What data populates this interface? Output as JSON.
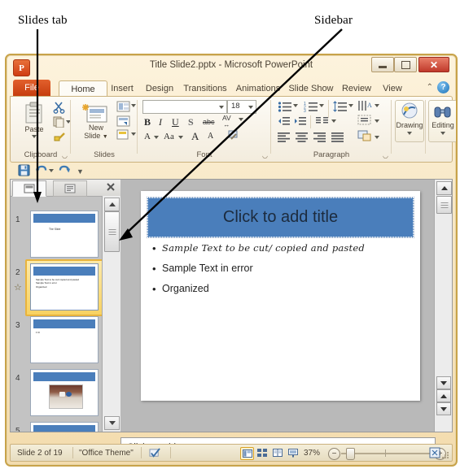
{
  "annotations": [
    {
      "id": "slides-tab",
      "label": "Slides tab"
    },
    {
      "id": "sidebar",
      "label": "Sidebar"
    }
  ],
  "window": {
    "title": "Title Slide2.pptx  -  Microsoft PowerPoint",
    "logo_text": "P",
    "buttons": {
      "minimize": "minimize-button",
      "maximize": "maximize-button",
      "close": "✕"
    }
  },
  "ribbon": {
    "file_tab": "File",
    "tabs": [
      {
        "label": "Home",
        "active": true
      },
      {
        "label": "Insert",
        "active": false
      },
      {
        "label": "Design",
        "active": false
      },
      {
        "label": "Transitions",
        "active": false
      },
      {
        "label": "Animations",
        "active": false
      },
      {
        "label": "Slide Show",
        "active": false
      },
      {
        "label": "Review",
        "active": false
      },
      {
        "label": "View",
        "active": false
      }
    ],
    "help_label": "?",
    "collapse_label": "⌃",
    "groups": [
      {
        "name": "Clipboard",
        "label": "Clipboard"
      },
      {
        "name": "Slides",
        "label": "Slides"
      },
      {
        "name": "Font",
        "label": "Font"
      },
      {
        "name": "Paragraph",
        "label": "Paragraph"
      },
      {
        "name": "Drawing",
        "label": "Drawing"
      },
      {
        "name": "Editing",
        "label": "Editing"
      }
    ],
    "clipboard": {
      "paste_label": "Paste"
    },
    "slides": {
      "new_slide_label": "New\nSlide"
    },
    "font": {
      "font_name_value": "",
      "font_size_value": "18",
      "bold": "B",
      "italic": "I",
      "underline": "U",
      "shadow": "S",
      "strikethrough": "abc",
      "spacing": "AV",
      "case_label": "Aa",
      "grow": "A",
      "shrink": "A",
      "color_label": "A"
    },
    "drawing": {
      "label": "Drawing"
    },
    "editing": {
      "label": "Editing"
    }
  },
  "quick_access": {
    "items": [
      {
        "name": "save-button",
        "label": "Save"
      },
      {
        "name": "undo-button",
        "label": "Undo"
      },
      {
        "name": "redo-button",
        "label": "Redo"
      },
      {
        "name": "customize-qat-button",
        "label": "Customize Quick Access Toolbar"
      }
    ]
  },
  "slides_pane": {
    "tabs": [
      {
        "name": "slides",
        "label": "Slides",
        "active": true
      },
      {
        "name": "outline",
        "label": "Outline",
        "active": false
      }
    ],
    "close_label": "✕",
    "thumbnails": [
      {
        "number": "1",
        "selected": false,
        "kind": "title",
        "caption": "The Slide"
      },
      {
        "number": "2",
        "selected": true,
        "kind": "bullets",
        "has_animation": true,
        "lines": [
          "Sample Text to be cut/ copied and pasted",
          "Sample Text in error",
          "Organized"
        ]
      },
      {
        "number": "3",
        "selected": false,
        "kind": "short",
        "lines": [
          "• ••"
        ]
      },
      {
        "number": "4",
        "selected": false,
        "kind": "image"
      },
      {
        "number": "5",
        "selected": false,
        "kind": "title"
      }
    ]
  },
  "slide": {
    "title_placeholder": "Click to add title",
    "bullets": [
      {
        "text": "Sample Text to be cut/ copied and pasted",
        "style": "script"
      },
      {
        "text": "Sample Text in error",
        "style": "normal"
      },
      {
        "text": "Organized",
        "style": "normal"
      }
    ]
  },
  "notes": {
    "placeholder": "Click to add notes"
  },
  "status_bar": {
    "slide_counter": "Slide 2 of 19",
    "theme": "\"Office Theme\"",
    "spellcheck_name": "spellcheck-icon",
    "views": [
      {
        "name": "normal-view-button",
        "active": true
      },
      {
        "name": "slide-sorter-view-button",
        "active": false
      },
      {
        "name": "reading-view-button",
        "active": false
      },
      {
        "name": "slideshow-view-button",
        "active": false
      }
    ],
    "zoom_level": "37%",
    "zoom_out_label": "−",
    "zoom_in_label": "+",
    "fit_label": "fit-to-window-button"
  },
  "colors": {
    "accent_blue": "#4a7ebb",
    "window_chrome": "#f3dcae",
    "file_tab_orange": "#c63d0f",
    "selection_gold": "#e8b33c"
  }
}
